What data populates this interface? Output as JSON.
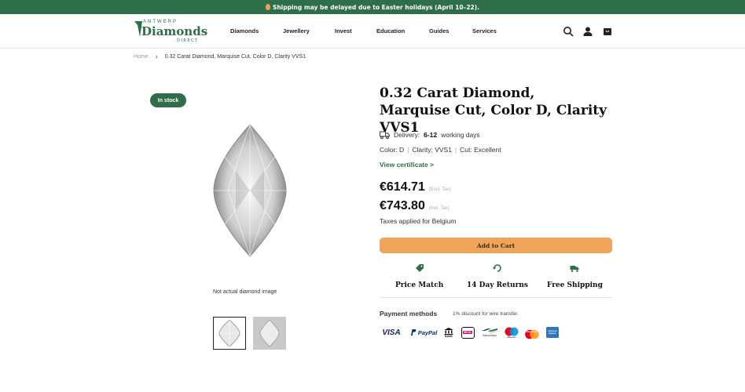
{
  "announcement": {
    "text": "Shipping may be delayed due to Easter holidays (April 10–22)."
  },
  "logo": {
    "top": "ANTWERP",
    "main": "Diamonds",
    "bottom": ".DIRECT"
  },
  "nav": {
    "items": [
      "Diamonds",
      "Jewellery",
      "Invest",
      "Education",
      "Guides",
      "Services"
    ]
  },
  "header_icons": [
    "search-icon",
    "account-icon",
    "cart-icon"
  ],
  "breadcrumb": {
    "home": "Home",
    "current": "0.32 Carat Diamond, Marquise Cut, Color D, Clarity VVS1"
  },
  "gallery": {
    "badge": "In stock",
    "note": "Not actual diamond image"
  },
  "product": {
    "title": "0.32 Carat Diamond, Marquise Cut, Color D, Clarity VVS1",
    "delivery_label": "Delivery:",
    "delivery_value": "6-12",
    "delivery_suffix": "working days",
    "specs": [
      "Color: D",
      "Clarity: VVS1",
      "Cut: Excellent"
    ],
    "certificate_link": "View certificate >",
    "price_excl": "€614.71",
    "price_excl_note": "(Excl. Tax)",
    "price_incl": "€743.80",
    "price_incl_note": "(Incl. Tax)",
    "taxes_note": "Taxes applied for Belgium",
    "add_to_cart": "Add to Cart"
  },
  "features": [
    "Price Match",
    "14 Day Returns",
    "Free Shipping"
  ],
  "payment": {
    "title": "Payment methods",
    "note": "1% discount for wire transfer.",
    "methods": [
      "VISA",
      "PayPal",
      "BANK",
      "iDEAL",
      "Bancontact",
      "Maestro",
      "Mastercard",
      "American Express"
    ]
  },
  "colors": {
    "brand_green": "#2e6e48",
    "cart_orange": "#f0a45a"
  }
}
